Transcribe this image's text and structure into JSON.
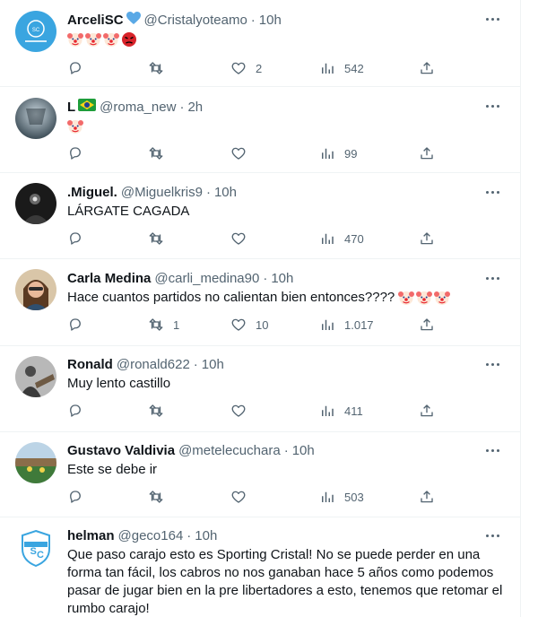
{
  "colors": {
    "text": "#0f1419",
    "secondary": "#536471",
    "divider": "#eff3f4",
    "brand_sc": "#3aa5e0"
  },
  "tweets": [
    {
      "name": "ArceliSC",
      "name_suffix_icon": "blue-heart-icon",
      "handle": "@Cristalyoteamo",
      "dot": "·",
      "time": "10h",
      "text": "",
      "emojis": [
        "clown-face-icon",
        "clown-face-icon",
        "clown-face-icon",
        "red-angry-icon"
      ],
      "replies": "",
      "retweets": "",
      "likes": "2",
      "views": "542"
    },
    {
      "name": "L",
      "name_suffix_icon": "brazil-flag-icon",
      "handle": "@roma_new",
      "dot": "·",
      "time": "2h",
      "text": "",
      "emojis": [
        "clown-face-icon"
      ],
      "replies": "",
      "retweets": "",
      "likes": "",
      "views": "99"
    },
    {
      "name": ".Miguel.",
      "handle": "@Miguelkris9",
      "dot": "·",
      "time": "10h",
      "text": "LÁRGATE CAGADA",
      "emojis": [],
      "replies": "",
      "retweets": "",
      "likes": "",
      "views": "470"
    },
    {
      "name": "Carla Medina",
      "handle": "@carli_medina90",
      "dot": "·",
      "time": "10h",
      "text": "Hace cuantos partidos no calientan bien entonces????",
      "emojis": [
        "clown-face-icon",
        "clown-face-icon",
        "clown-face-icon"
      ],
      "replies": "",
      "retweets": "1",
      "likes": "10",
      "views": "1.017"
    },
    {
      "name": "Ronald",
      "handle": "@ronald622",
      "dot": "·",
      "time": "10h",
      "text": "Muy lento castillo",
      "emojis": [],
      "replies": "",
      "retweets": "",
      "likes": "",
      "views": "411"
    },
    {
      "name": "Gustavo Valdivia",
      "handle": "@metelecuchara",
      "dot": "·",
      "time": "10h",
      "text": "Este se debe ir",
      "emojis": [],
      "replies": "",
      "retweets": "",
      "likes": "",
      "views": "503"
    },
    {
      "name": "helman",
      "handle": "@geco164",
      "dot": "·",
      "time": "10h",
      "text": "Que paso carajo esto es Sporting Cristal! No se puede perder en una forma tan fácil, los cabros no nos ganaban hace 5 años como podemos pasar de jugar bien en la pre libertadores a esto, tenemos que retomar el rumbo carajo!",
      "emojis": []
    }
  ]
}
